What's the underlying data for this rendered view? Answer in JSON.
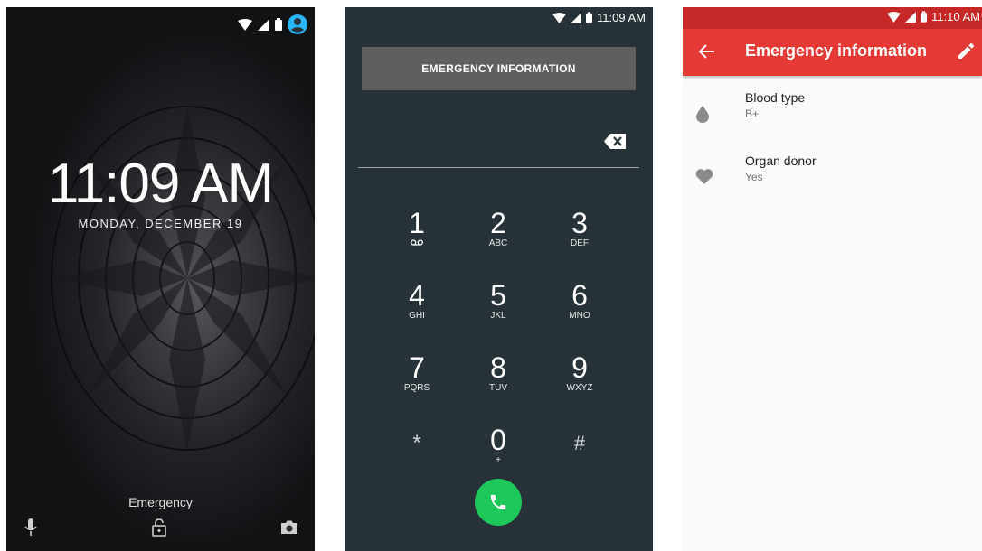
{
  "lock_screen": {
    "time": "11:09 AM",
    "date": "MONDAY, DECEMBER 19",
    "emergency_label": "Emergency",
    "icons": [
      "wifi-icon",
      "cell-signal-icon",
      "battery-icon",
      "user-avatar-icon",
      "microphone-icon",
      "unlock-icon",
      "camera-icon"
    ]
  },
  "dialer": {
    "status_time": "11:09 AM",
    "emergency_info_button": "EMERGENCY INFORMATION",
    "keys": [
      {
        "digit": "1",
        "letters": ""
      },
      {
        "digit": "2",
        "letters": "ABC"
      },
      {
        "digit": "3",
        "letters": "DEF"
      },
      {
        "digit": "4",
        "letters": "GHI"
      },
      {
        "digit": "5",
        "letters": "JKL"
      },
      {
        "digit": "6",
        "letters": "MNO"
      },
      {
        "digit": "7",
        "letters": "PQRS"
      },
      {
        "digit": "8",
        "letters": "TUV"
      },
      {
        "digit": "9",
        "letters": "WXYZ"
      },
      {
        "digit": "*",
        "letters": ""
      },
      {
        "digit": "0",
        "letters": "+"
      },
      {
        "digit": "#",
        "letters": ""
      }
    ],
    "call_button_color": "#1ec75a"
  },
  "emergency_info": {
    "status_time": "11:10 AM",
    "title": "Emergency information",
    "items": [
      {
        "title": "Blood type",
        "value": "B+",
        "icon": "blood-drop-icon"
      },
      {
        "title": "Organ donor",
        "value": "Yes",
        "icon": "heart-icon"
      }
    ],
    "appbar_color": "#e53935",
    "statusbar_color": "#c62828"
  }
}
